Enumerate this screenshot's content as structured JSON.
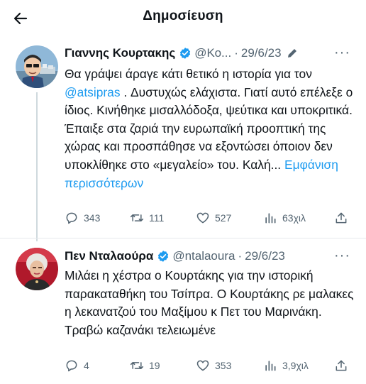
{
  "header": {
    "title": "Δημοσίευση",
    "back_icon": "arrow-left-icon"
  },
  "tweets": [
    {
      "name": "Γιαννης Κουρτακης",
      "handle": "@Κο...",
      "dot": "·",
      "date": "29/6/23",
      "edited_icon": "pencil-icon",
      "more": "···",
      "verified_color": "#1d9bf0",
      "text_before": "Θα γράψει άραγε κάτι θετικό η ιστορία για τον",
      "mention": "@atsipras",
      "text_after": ". Δυστυχώς ελάχιστα. Γιατί αυτό επέλεξε ο ίδιος. Κινήθηκε μισαλλόδοξα, ψεύτικα και υποκριτικά. Έπαιξε στα ζαριά την ευρωπαϊκή προοπτική της χώρας και προσπάθησε να εξοντώσει όποιον δεν υποκλίθηκε στο «μεγαλείο» του. Καλή...",
      "show_more": "Εμφάνιση περισσότερων",
      "replies": "343",
      "reposts": "111",
      "likes": "527",
      "views": "63χιλ"
    },
    {
      "name": "Πεν Νταλαούρα",
      "handle": "@ntalaoura",
      "dot": "·",
      "date": "29/6/23",
      "more": "···",
      "verified_color": "#1d9bf0",
      "text": "Μιλάει η χέστρα ο Κουρτάκης για την ιστορική παρακαταθήκη του Τσίπρα. Ο Κουρτάκης ρε μαλακες η λεκανατζού του Μαξίμου κ Πετ του Μαρινάκη. Τραβώ καζανάκι τελειωμένε",
      "replies": "4",
      "reposts": "19",
      "likes": "353",
      "views": "3,9χιλ"
    }
  ]
}
